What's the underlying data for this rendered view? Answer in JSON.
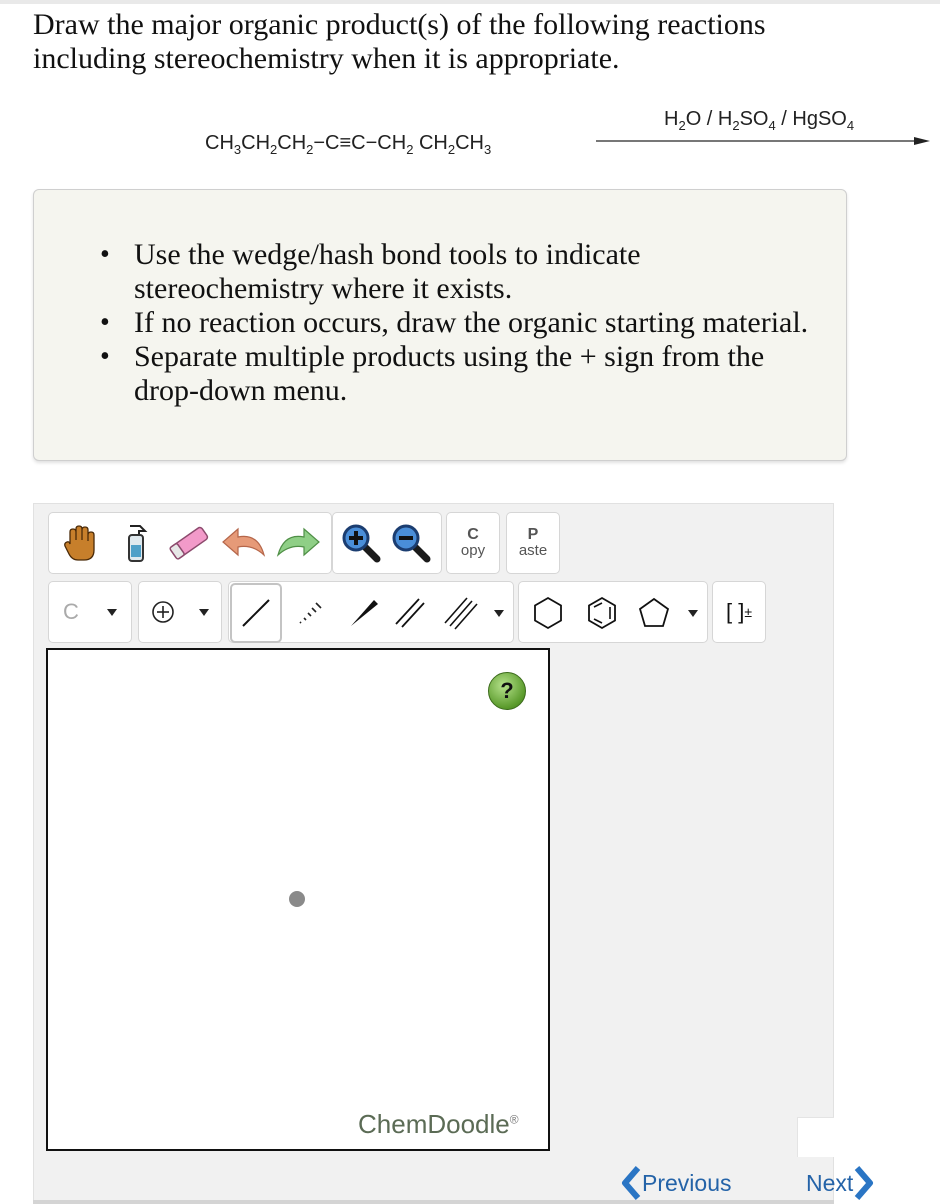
{
  "question": {
    "line1": "Draw the major organic product(s) of the following reactions",
    "line2": "including stereochemistry when it is appropriate."
  },
  "reaction": {
    "reactant": [
      "CH",
      "3",
      "CH",
      "2",
      "CH",
      "2",
      "−C≡C−CH",
      "2",
      " CH",
      "2",
      "CH",
      "3"
    ],
    "reagents": [
      "H",
      "2",
      "O / H",
      "2",
      "SO",
      "4",
      " / HgSO",
      "4"
    ]
  },
  "instructions": [
    "Use the wedge/hash bond tools to indicate stereochemistry where it exists.",
    "If no reaction occurs, draw the organic starting material.",
    "Separate multiple products using the + sign from the drop-down menu."
  ],
  "toolbar": {
    "copy_big": "C",
    "copy_small": "opy",
    "paste_big": "P",
    "paste_small": "aste",
    "element_label": "C",
    "bracket_label": "[ ]",
    "bracket_sup": "±"
  },
  "canvas": {
    "help_label": "?",
    "brand": "ChemDoodle",
    "brand_mark": "®"
  },
  "nav": {
    "previous": "Previous",
    "next": "Next"
  },
  "colors": {
    "nav_link": "#2463a8",
    "help_green": "#5a9a2b",
    "panel_bg": "#f5f5ef"
  }
}
